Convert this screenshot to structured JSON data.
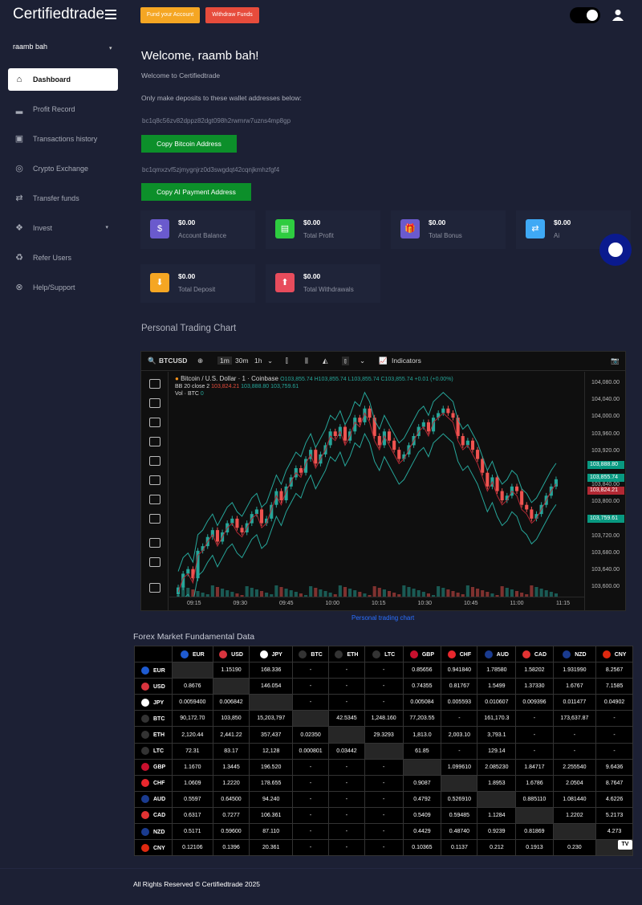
{
  "brand": "Certifiedtrade",
  "topbar": {
    "fund_label": "Fund your Account",
    "withdraw_label": "Withdraw Funds",
    "fund_color": "#f5a623",
    "withdraw_color": "#e74c3c"
  },
  "sidebar": {
    "username": "raamb bah",
    "items": [
      {
        "label": "Dashboard",
        "icon": "home-icon",
        "active": true
      },
      {
        "label": "Profit Record",
        "icon": "signal-bars-icon"
      },
      {
        "label": "Transactions history",
        "icon": "briefcase-icon"
      },
      {
        "label": "Crypto Exchange",
        "icon": "coins-icon"
      },
      {
        "label": "Transfer funds",
        "icon": "exchange-arrows-icon"
      },
      {
        "label": "Invest",
        "icon": "cubes-icon",
        "has_submenu": true
      },
      {
        "label": "Refer Users",
        "icon": "recycle-icon"
      },
      {
        "label": "Help/Support",
        "icon": "lifebuoy-icon"
      }
    ]
  },
  "welcome": {
    "title": "Welcome, raamb bah!",
    "subtitle": "Welcome to Certifiedtrade",
    "notice": "Only make deposits to these wallet addresses below:",
    "btc_address": "bc1q8c56zv82dppz82dgt098h2rwmrw7uzns4mp8gp",
    "btc_button": "Copy Bitcoin Address",
    "ai_address": "bc1qmxzvf5zjmygnjrz0d3swgdqt42cqnjkmhzfgf4",
    "ai_button": "Copy AI Payment Address"
  },
  "cards": [
    {
      "value": "$0.00",
      "label": "Account Balance",
      "color": "#6a5acd",
      "icon": "$"
    },
    {
      "value": "$0.00",
      "label": "Total Profit",
      "color": "#2ecc40",
      "icon": "▤"
    },
    {
      "value": "$0.00",
      "label": "Total Bonus",
      "color": "#6a5acd",
      "icon": "🎁"
    },
    {
      "value": "$0.00",
      "label": "Ai",
      "color": "#3fa9f5",
      "icon": "⇄"
    },
    {
      "value": "$0.00",
      "label": "Total Deposit",
      "color": "#f5a623",
      "icon": "⬇"
    },
    {
      "value": "$0.00",
      "label": "Total Withdrawals",
      "color": "#e74c5c",
      "icon": "⬆"
    }
  ],
  "chart_section": {
    "title": "Personal Trading Chart",
    "caption": "Personal trading chart",
    "symbol": "BTCUSD",
    "intervals": [
      "1m",
      "30m",
      "1h"
    ],
    "indicators_label": "Indicators",
    "legend_title": "Bitcoin / U.S. Dollar · 1 · Coinbase",
    "ohlc": "O103,855.74 H103,855.74 L103,855.74 C103,855.74 +0.01 (+0.00%)",
    "bb_label": "BB 20 close 2",
    "bb_values": [
      "103,824.21",
      "103,888.80",
      "103,759.61"
    ],
    "vol_label": "Vol · BTC",
    "vol_value": "0",
    "price_tags": [
      {
        "text": "103,888.80",
        "color": "#089981"
      },
      {
        "text": "103,855.74",
        "color": "#089981"
      },
      {
        "text": "103,824.21",
        "color": "#b22833"
      },
      {
        "text": "103,759.61",
        "color": "#089981"
      }
    ],
    "y_ticks": [
      "104,080.00",
      "104,040.00",
      "104,000.00",
      "103,960.00",
      "103,920.00",
      "103,880.00",
      "103,840.00",
      "103,800.00",
      "103,760.00",
      "103,720.00",
      "103,680.00",
      "103,640.00",
      "103,600.00"
    ],
    "x_ticks": [
      "09:15",
      "09:30",
      "09:45",
      "10:00",
      "10:15",
      "10:30",
      "10:45",
      "11:00",
      "11:15"
    ]
  },
  "chart_data": {
    "type": "candlestick",
    "ylim": [
      103600,
      104090
    ],
    "close": [
      103620,
      103650,
      103660,
      103640,
      103700,
      103710,
      103730,
      103745,
      103720,
      103740,
      103760,
      103770,
      103750,
      103740,
      103760,
      103780,
      103790,
      103760,
      103770,
      103800,
      103830,
      103810,
      103840,
      103860,
      103880,
      103870,
      103900,
      103920,
      103890,
      103910,
      103930,
      103960,
      103950,
      103970,
      103940,
      103960,
      103990,
      103980,
      104010,
      103990,
      103950,
      103930,
      103960,
      103940,
      103920,
      103900,
      103910,
      103930,
      103950,
      103970,
      103980,
      103960,
      103990,
      104000,
      104010,
      104000,
      103990,
      103950,
      103930,
      103940,
      103920,
      103900,
      103870,
      103840,
      103860,
      103830,
      103810,
      103820,
      103840,
      103830,
      103800,
      103790,
      103770,
      103780,
      103800,
      103820,
      103840,
      103855.74
    ]
  },
  "forex": {
    "title": "Forex Market Fundamental Data",
    "columns": [
      {
        "code": "EUR",
        "color": "#1e5bd1"
      },
      {
        "code": "USD",
        "color": "#d8343e"
      },
      {
        "code": "JPY",
        "color": "#ffffff"
      },
      {
        "code": "BTC",
        "color": "#333333"
      },
      {
        "code": "ETH",
        "color": "#333333"
      },
      {
        "code": "LTC",
        "color": "#333333"
      },
      {
        "code": "GBP",
        "color": "#c8102e"
      },
      {
        "code": "CHF",
        "color": "#e8272d"
      },
      {
        "code": "AUD",
        "color": "#1a3b8f"
      },
      {
        "code": "CAD",
        "color": "#e23333"
      },
      {
        "code": "NZD",
        "color": "#1a3b8f"
      },
      {
        "code": "CNY",
        "color": "#de2910"
      }
    ],
    "rows": [
      [
        "EUR",
        "",
        "1.15190",
        "168.336",
        "-",
        "-",
        "-",
        "0.85656",
        "0.941840",
        "1.78580",
        "1.58202",
        "1.931990",
        "8.2567"
      ],
      [
        "USD",
        "0.8676",
        "",
        "146.054",
        "-",
        "-",
        "-",
        "0.74355",
        "0.81767",
        "1.5499",
        "1.37330",
        "1.6767",
        "7.1585"
      ],
      [
        "JPY",
        "0.0059400",
        "0.006842",
        "",
        "-",
        "-",
        "-",
        "0.005084",
        "0.005593",
        "0.010607",
        "0.009396",
        "0.011477",
        "0.04902"
      ],
      [
        "BTC",
        "90,172.70",
        "103,850",
        "15,203,797",
        "",
        "42.5345",
        "1,248.160",
        "77,203.55",
        "-",
        "161,170.3",
        "-",
        "173,637.87",
        "-"
      ],
      [
        "ETH",
        "2,120.44",
        "2,441.22",
        "357,437",
        "0.02350",
        "",
        "29.3293",
        "1,813.0",
        "2,003.10",
        "3,793.1",
        "-",
        "-",
        "-"
      ],
      [
        "LTC",
        "72.31",
        "83.17",
        "12,128",
        "0.000801",
        "0.03442",
        "",
        "61.85",
        "-",
        "129.14",
        "-",
        "-",
        "-"
      ],
      [
        "GBP",
        "1.1670",
        "1.3445",
        "196.520",
        "-",
        "-",
        "-",
        "",
        "1.099610",
        "2.085230",
        "1.84717",
        "2.255540",
        "9.6436"
      ],
      [
        "CHF",
        "1.0609",
        "1.2220",
        "178.655",
        "-",
        "-",
        "-",
        "0.9087",
        "",
        "1.8953",
        "1.6786",
        "2.0504",
        "8.7647"
      ],
      [
        "AUD",
        "0.5597",
        "0.64500",
        "94.240",
        "-",
        "-",
        "-",
        "0.4792",
        "0.526910",
        "",
        "0.885110",
        "1.081440",
        "4.6226"
      ],
      [
        "CAD",
        "0.6317",
        "0.7277",
        "106.361",
        "-",
        "-",
        "-",
        "0.5409",
        "0.59485",
        "1.1284",
        "",
        "1.2202",
        "5.2173"
      ],
      [
        "NZD",
        "0.5171",
        "0.59600",
        "87.110",
        "-",
        "-",
        "-",
        "0.4429",
        "0.48740",
        "0.9239",
        "0.81869",
        "",
        "4.273"
      ],
      [
        "CNY",
        "0.12106",
        "0.1396",
        "20.361",
        "-",
        "-",
        "-",
        "0.10365",
        "0.1137",
        "0.212",
        "0.1913",
        "0.230",
        ""
      ]
    ]
  },
  "footer": "All Rights Reserved © Certifiedtrade 2025"
}
